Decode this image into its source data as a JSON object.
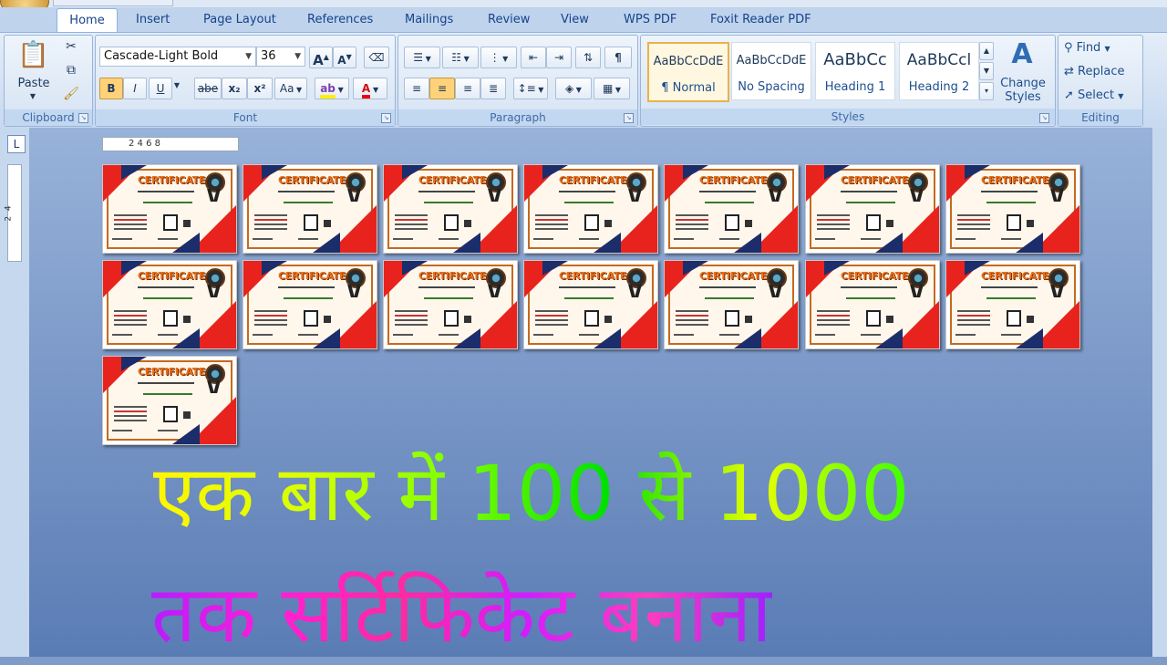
{
  "tabs": [
    "Home",
    "Insert",
    "Page Layout",
    "References",
    "Mailings",
    "Review",
    "View",
    "WPS PDF",
    "Foxit Reader PDF"
  ],
  "clipboard": {
    "paste_label": "Paste",
    "group_label": "Clipboard"
  },
  "font": {
    "name": "Cascade-Light Bold",
    "size": "36",
    "group_label": "Font",
    "bold": "B",
    "italic": "I",
    "underline": "U",
    "strike": "abe",
    "subscript": "x₂",
    "superscript": "x²",
    "change_case": "Aa",
    "grow": "A",
    "shrink": "A",
    "clear": "A"
  },
  "paragraph": {
    "group_label": "Paragraph"
  },
  "styles": {
    "group_label": "Styles",
    "items": [
      {
        "preview": "AaBbCcDdE",
        "name": "¶ Normal"
      },
      {
        "preview": "AaBbCcDdE",
        "name": "No Spacing"
      },
      {
        "preview": "AaBbCc",
        "name": "Heading 1"
      },
      {
        "preview": "AaBbCcl",
        "name": "Heading 2"
      }
    ],
    "change_styles": "Change Styles"
  },
  "editing": {
    "group_label": "Editing",
    "find": "Find",
    "replace": "Replace",
    "select": "Select"
  },
  "ruler": {
    "marks": "2  4  6  8",
    "vmarks": "2  4"
  },
  "certificate": {
    "title": "CERTIFICATE"
  },
  "overlay": {
    "line1": "एक बार में 100 से 1000",
    "line2": "तक सर्टिफिकेट बनाना"
  },
  "colors": {
    "accent_red": "#e8231e",
    "accent_navy": "#1c2d6b",
    "ribbon_bg": "#dbe7f6"
  }
}
